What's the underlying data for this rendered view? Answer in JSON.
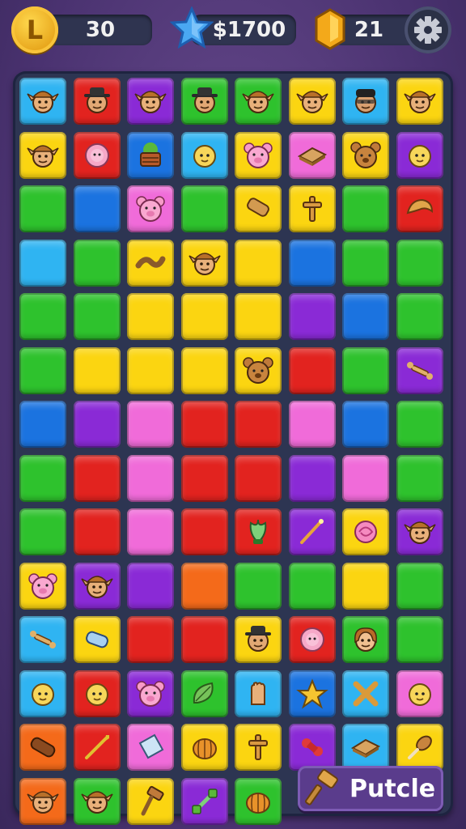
{
  "hud": {
    "coins": "30",
    "money": "$1700",
    "gems": "21",
    "coin_symbol": "L"
  },
  "action_button": {
    "label": "Putcle"
  },
  "colors": {
    "cyan": "#2fb4f2",
    "red": "#e2231f",
    "purple": "#8a2ad6",
    "green": "#2ec22d",
    "yellow": "#fbd511",
    "blue": "#1b73e0",
    "pink": "#f06bd9",
    "orange": "#f46a1a"
  },
  "board": {
    "rows": [
      [
        [
          "cyan",
          "elf-face-icon"
        ],
        [
          "red",
          "cowboy-face-icon"
        ],
        [
          "purple",
          "elf-face-icon"
        ],
        [
          "green",
          "cowboy-face-icon"
        ],
        [
          "green",
          "elf-face-icon"
        ],
        [
          "yellow",
          "elf-face-icon"
        ],
        [
          "cyan",
          "bandit-face-icon"
        ],
        [
          "yellow",
          "elf-face-icon"
        ]
      ],
      [
        [
          "yellow",
          "elf-face-icon"
        ],
        [
          "red",
          "flower-icon"
        ],
        [
          "blue",
          "basket-icon"
        ],
        [
          "cyan",
          "baby-face-icon"
        ],
        [
          "yellow",
          "pig-face-icon"
        ],
        [
          "pink",
          "sandwich-icon"
        ],
        [
          "yellow",
          "bear-face-icon"
        ],
        [
          "purple",
          "baby-face-icon"
        ]
      ],
      [
        [
          "green",
          ""
        ],
        [
          "blue",
          ""
        ],
        [
          "pink",
          "pig-face-icon"
        ],
        [
          "green",
          ""
        ],
        [
          "yellow",
          "bread-icon"
        ],
        [
          "yellow",
          "cross-icon"
        ],
        [
          "green",
          ""
        ],
        [
          "red",
          "croissant-icon"
        ]
      ],
      [
        [
          "cyan",
          ""
        ],
        [
          "green",
          ""
        ],
        [
          "yellow",
          "rope-icon"
        ],
        [
          "yellow",
          "elf-face-icon"
        ],
        [
          "yellow",
          ""
        ],
        [
          "blue",
          ""
        ],
        [
          "green",
          ""
        ],
        [
          "green",
          ""
        ]
      ],
      [
        [
          "green",
          ""
        ],
        [
          "green",
          ""
        ],
        [
          "yellow",
          ""
        ],
        [
          "yellow",
          ""
        ],
        [
          "yellow",
          ""
        ],
        [
          "purple",
          ""
        ],
        [
          "blue",
          ""
        ],
        [
          "green",
          ""
        ]
      ],
      [
        [
          "green",
          ""
        ],
        [
          "yellow",
          ""
        ],
        [
          "yellow",
          ""
        ],
        [
          "yellow",
          ""
        ],
        [
          "yellow",
          "bear-face-icon"
        ],
        [
          "red",
          ""
        ],
        [
          "green",
          ""
        ],
        [
          "purple",
          "bone-icon"
        ]
      ],
      [
        [
          "blue",
          ""
        ],
        [
          "purple",
          ""
        ],
        [
          "pink",
          ""
        ],
        [
          "red",
          ""
        ],
        [
          "red",
          ""
        ],
        [
          "pink",
          ""
        ],
        [
          "blue",
          ""
        ],
        [
          "green",
          ""
        ]
      ],
      [
        [
          "green",
          ""
        ],
        [
          "red",
          ""
        ],
        [
          "pink",
          ""
        ],
        [
          "red",
          ""
        ],
        [
          "red",
          ""
        ],
        [
          "purple",
          ""
        ],
        [
          "pink",
          ""
        ],
        [
          "green",
          ""
        ]
      ],
      [
        [
          "green",
          ""
        ],
        [
          "red",
          ""
        ],
        [
          "pink",
          ""
        ],
        [
          "red",
          ""
        ],
        [
          "red",
          "plant-icon"
        ],
        [
          "purple",
          "wand-icon"
        ],
        [
          "yellow",
          "rose-icon"
        ],
        [
          "purple",
          "elf-face-icon"
        ]
      ],
      [
        [
          "yellow",
          "pig-face-icon"
        ],
        [
          "purple",
          "elf-face-icon"
        ],
        [
          "purple",
          ""
        ],
        [
          "orange",
          ""
        ],
        [
          "green",
          ""
        ],
        [
          "green",
          ""
        ],
        [
          "yellow",
          ""
        ],
        [
          "green",
          ""
        ]
      ],
      [
        [
          "cyan",
          "bone-icon"
        ],
        [
          "yellow",
          "scroll-icon"
        ],
        [
          "red",
          ""
        ],
        [
          "red",
          ""
        ],
        [
          "yellow",
          "cowboy-face-icon"
        ],
        [
          "red",
          "flower-icon"
        ],
        [
          "green",
          "girl-face-icon"
        ],
        [
          "green",
          ""
        ]
      ],
      [
        [
          "cyan",
          "baby-face-icon"
        ],
        [
          "red",
          "baby-face-icon"
        ],
        [
          "purple",
          "pig-face-icon"
        ],
        [
          "green",
          "leaf-icon"
        ],
        [
          "cyan",
          "hand-icon"
        ],
        [
          "blue",
          "star-icon"
        ],
        [
          "cyan",
          "x-mark-icon"
        ],
        [
          "pink",
          "baby-face-icon"
        ]
      ],
      [
        [
          "orange",
          "log-icon"
        ],
        [
          "red",
          "arrow-icon"
        ],
        [
          "pink",
          "crystal-icon"
        ],
        [
          "yellow",
          "pumpkin-icon"
        ],
        [
          "yellow",
          "cross-icon"
        ],
        [
          "purple",
          "bow-icon"
        ],
        [
          "cyan",
          "sandwich-icon"
        ],
        [
          "yellow",
          "drumstick-icon"
        ]
      ],
      [
        [
          "orange",
          "elf-face-icon"
        ],
        [
          "green",
          "elf-face-icon"
        ],
        [
          "yellow",
          "hammer-icon"
        ],
        [
          "purple",
          "dumbbell-icon"
        ],
        [
          "green",
          "pumpkin-icon"
        ]
      ]
    ]
  }
}
